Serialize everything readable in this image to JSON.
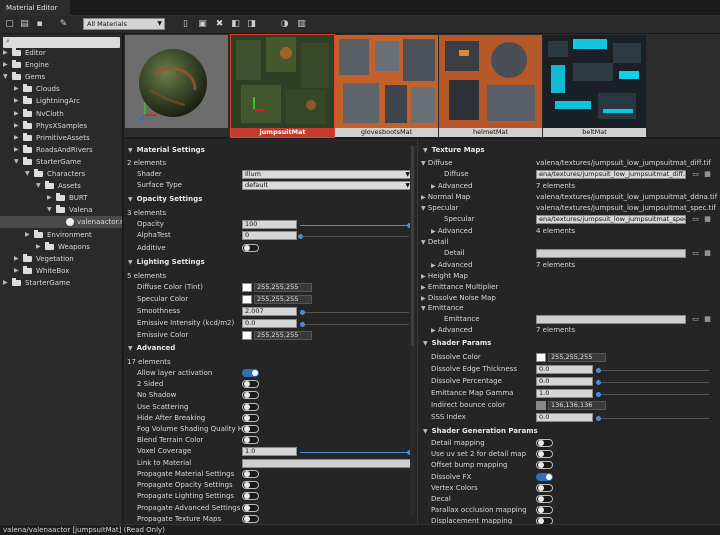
{
  "window": {
    "title": "Material Editor"
  },
  "toolbar": {
    "filter_value": "All Materials"
  },
  "tree": {
    "items": [
      {
        "label": "Editor",
        "depth": 0,
        "kind": "folder",
        "expanded": false
      },
      {
        "label": "Engine",
        "depth": 0,
        "kind": "folder",
        "expanded": false
      },
      {
        "label": "Gems",
        "depth": 0,
        "kind": "folder",
        "expanded": true
      },
      {
        "label": "Clouds",
        "depth": 1,
        "kind": "folder",
        "expanded": false
      },
      {
        "label": "LightningArc",
        "depth": 1,
        "kind": "folder",
        "expanded": false
      },
      {
        "label": "NvCloth",
        "depth": 1,
        "kind": "folder",
        "expanded": false
      },
      {
        "label": "PhysXSamples",
        "depth": 1,
        "kind": "folder",
        "expanded": false
      },
      {
        "label": "PrimitiveAssets",
        "depth": 1,
        "kind": "folder",
        "expanded": false
      },
      {
        "label": "RoadsAndRivers",
        "depth": 1,
        "kind": "folder",
        "expanded": false
      },
      {
        "label": "StarterGame",
        "depth": 1,
        "kind": "folder",
        "expanded": true
      },
      {
        "label": "Characters",
        "depth": 2,
        "kind": "folder",
        "expanded": true
      },
      {
        "label": "Assets",
        "depth": 3,
        "kind": "folder",
        "expanded": true
      },
      {
        "label": "BURT",
        "depth": 4,
        "kind": "folder",
        "expanded": false
      },
      {
        "label": "Valena",
        "depth": 4,
        "kind": "folder",
        "expanded": true
      },
      {
        "label": "valenaactor.m",
        "depth": 5,
        "kind": "file",
        "selected": true
      },
      {
        "label": "Environment",
        "depth": 2,
        "kind": "folder",
        "expanded": false
      },
      {
        "label": "Weapons",
        "depth": 3,
        "kind": "folder",
        "expanded": false
      },
      {
        "label": "Vegetation",
        "depth": 1,
        "kind": "folder",
        "expanded": false
      },
      {
        "label": "WhiteBox",
        "depth": 1,
        "kind": "folder",
        "expanded": false
      },
      {
        "label": "StarterGame",
        "depth": 0,
        "kind": "folder",
        "expanded": false
      }
    ]
  },
  "thumbnails": [
    {
      "label": "",
      "kind": "preview"
    },
    {
      "label": "jumpsuitMat",
      "kind": "green",
      "selected": true
    },
    {
      "label": "glovesbootsMat",
      "kind": "orange"
    },
    {
      "label": "helmetMat",
      "kind": "orange2"
    },
    {
      "label": "beltMat",
      "kind": "cyan"
    }
  ],
  "left": {
    "material_settings": {
      "title": "Material Settings",
      "count": "2 elements",
      "shader_label": "Shader",
      "shader_value": "Illum",
      "surface_label": "Surface Type",
      "surface_value": "default"
    },
    "opacity": {
      "title": "Opacity Settings",
      "count": "3 elements",
      "opacity_label": "Opacity",
      "opacity_value": "100",
      "opacity_level": 1.0,
      "alpha_label": "AlphaTest",
      "alpha_value": "0",
      "alpha_level": 0.0,
      "additive_label": "Additive",
      "additive_on": false
    },
    "lighting": {
      "title": "Lighting Settings",
      "count": "5 elements",
      "diffuse_label": "Diffuse Color (Tint)",
      "diffuse_value": "255,255,255",
      "specular_label": "Specular Color",
      "specular_value": "255,255,255",
      "smooth_label": "Smoothness",
      "smooth_value": "2.007",
      "emissive_int_label": "Emissive Intensity (kcd/m2)",
      "emissive_int_value": "0.0",
      "emissive_col_label": "Emissive Color",
      "emissive_col_value": "255,255,255"
    },
    "advanced": {
      "title": "Advanced",
      "count": "17 elements",
      "toggles": [
        {
          "label": "Allow layer activation",
          "on": true
        },
        {
          "label": "2 Sided",
          "on": false
        },
        {
          "label": "No Shadow",
          "on": false
        },
        {
          "label": "Use Scattering",
          "on": false
        },
        {
          "label": "Hide After Breaking",
          "on": false
        },
        {
          "label": "Fog Volume Shading Quality High",
          "on": false
        },
        {
          "label": "Blend Terrain Color",
          "on": false
        }
      ],
      "voxel_label": "Voxel Coverage",
      "voxel_value": "1.0",
      "link_label": "Link to Material",
      "link_value": "",
      "propagate": [
        {
          "label": "Propagate Material Settings",
          "on": false
        },
        {
          "label": "Propagate Opacity Settings",
          "on": false
        },
        {
          "label": "Propagate Lighting Settings",
          "on": false
        },
        {
          "label": "Propagate Advanced Settings",
          "on": false
        },
        {
          "label": "Propagate Texture Maps",
          "on": false
        }
      ]
    }
  },
  "right": {
    "texture_maps": {
      "title": "Texture Maps",
      "diffuse_label": "Diffuse",
      "diffuse_path": "valena/textures/jumpsuit_low_jumpsuitmat_diff.tif",
      "diffuse_sub_label": "Diffuse",
      "diffuse_field": "ena/textures/jumpsuit_low_jumpsuitmat_diff.tif",
      "advanced_label": "Advanced",
      "seven": "7 elements",
      "normal_label": "Normal Map",
      "normal_path": "valena/textures/jumpsuit_low_jumpsuitmat_ddna.tif",
      "specular_label": "Specular",
      "specular_path": "valena/textures/jumpsuit_low_jumpsuitmat_spec.tif",
      "specular_sub_label": "Specular",
      "specular_field": "ena/textures/jumpsuit_low_jumpsuitmat_spec.tif",
      "four": "4 elements",
      "detail_label": "Detail",
      "detail_sub_label": "Detail",
      "height_label": "Height Map",
      "emit_mult_label": "Emittance Multiplier",
      "dissolve_noise_label": "Dissolve Noise Map",
      "emittance_label": "Emittance",
      "emittance_sub_label": "Emittance"
    },
    "shader_params": {
      "title": "Shader Params",
      "dissolve_color_label": "Dissolve Color",
      "dissolve_color_value": "255,255,255",
      "edge_label": "Dissolve Edge Thickness",
      "edge_value": "0.0",
      "pct_label": "Dissolve Percentage",
      "pct_value": "0.0",
      "gamma_label": "Emittance Map Gamma",
      "gamma_value": "1.0",
      "bounce_label": "Indirect bounce color",
      "bounce_value": "136,136,136",
      "sss_label": "SSS Index",
      "sss_value": "0.0"
    },
    "gen_params": {
      "title": "Shader Generation Params",
      "toggles": [
        {
          "label": "Detail mapping",
          "on": false
        },
        {
          "label": "Use uv set 2 for detail map",
          "on": false
        },
        {
          "label": "Offset bump mapping",
          "on": false
        },
        {
          "label": "Dissolve FX",
          "on": true
        },
        {
          "label": "Vertex Colors",
          "on": false
        },
        {
          "label": "Decal",
          "on": false
        },
        {
          "label": "Parallax occlusion mapping",
          "on": false
        },
        {
          "label": "Displacement mapping",
          "on": false
        }
      ]
    }
  },
  "status": {
    "text": "valena/valenaactor [jumpsuitMat] (Read Only)"
  },
  "colors": {
    "accent": "#2f6fb8",
    "selection": "#c43a2c"
  }
}
